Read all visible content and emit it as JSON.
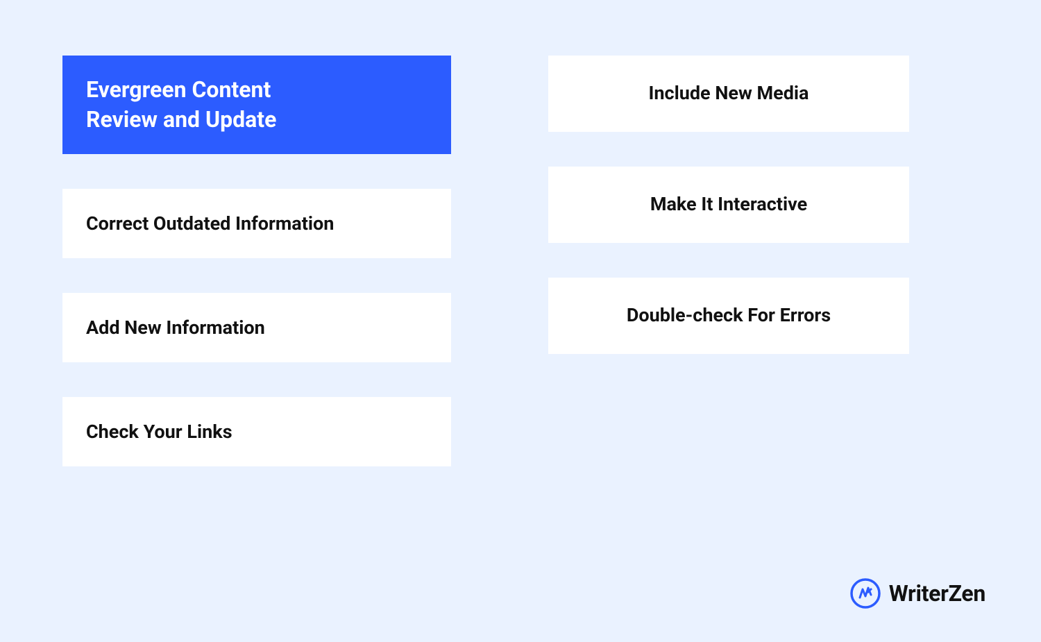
{
  "title": {
    "line1": "Evergreen Content",
    "line2": "Review and Update"
  },
  "left_column": {
    "items": [
      "Correct Outdated Information",
      "Add New Information",
      "Check Your Links"
    ]
  },
  "right_column": {
    "items": [
      "Include New Media",
      "Make It Interactive",
      "Double-check For Errors"
    ]
  },
  "brand": {
    "name": "WriterZen",
    "icon_color": "#2c5cff"
  }
}
